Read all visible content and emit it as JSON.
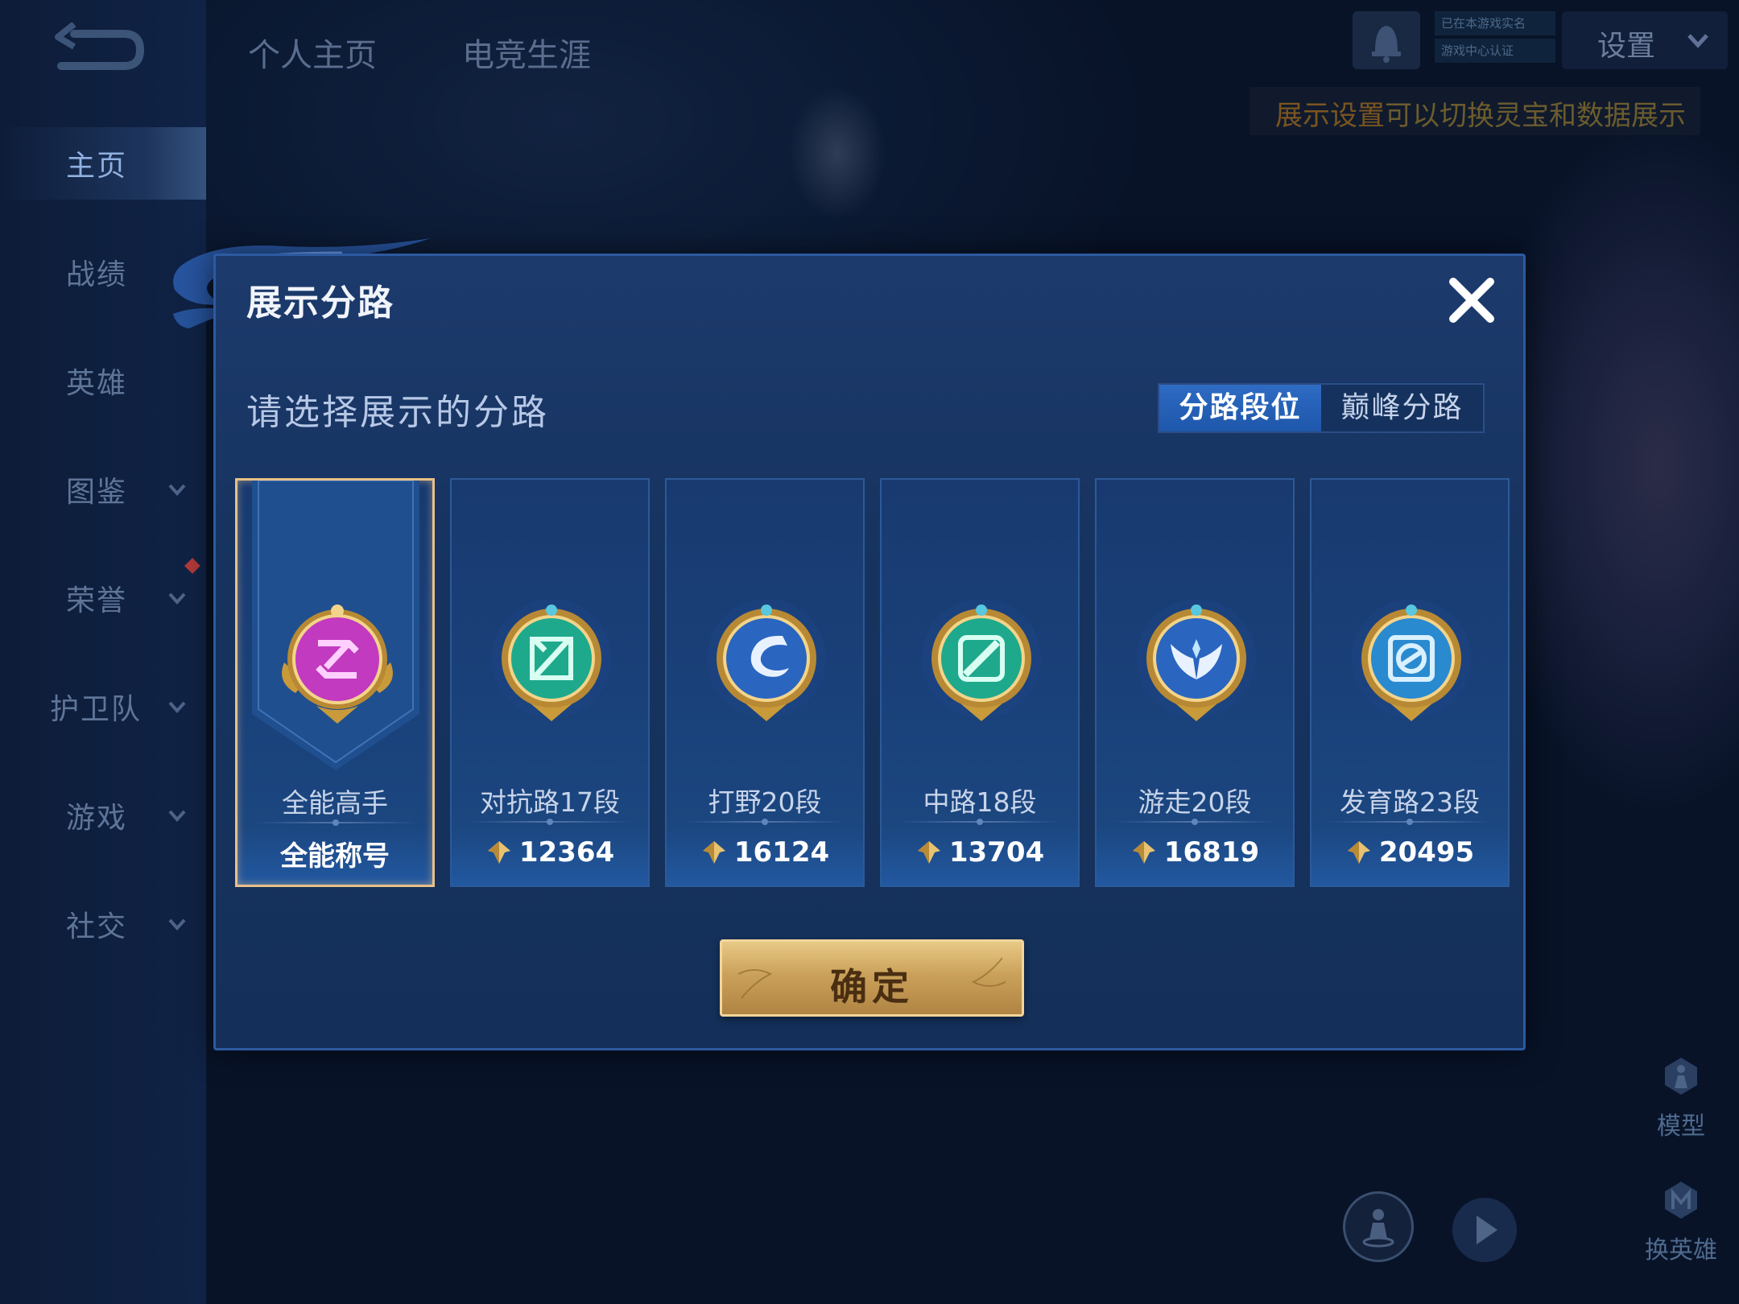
{
  "sidebar": {
    "items": [
      {
        "label": "主页",
        "active": true,
        "chevron": false
      },
      {
        "label": "战绩",
        "active": false,
        "chevron": false
      },
      {
        "label": "英雄",
        "active": false,
        "chevron": false
      },
      {
        "label": "图鉴",
        "active": false,
        "chevron": true
      },
      {
        "label": "荣誉",
        "active": false,
        "chevron": true
      },
      {
        "label": "护卫队",
        "active": false,
        "chevron": true
      },
      {
        "label": "游戏",
        "active": false,
        "chevron": true
      },
      {
        "label": "社交",
        "active": false,
        "chevron": true
      }
    ]
  },
  "topbar": {
    "tabs": [
      "个人主页",
      "电竞生涯"
    ],
    "verify_lines": [
      "已在本游戏实名",
      "游戏中心认证"
    ],
    "settings_label": "设置",
    "tip_highlight": "展示设置",
    "tip_text": "可以切换灵宝和数据展示"
  },
  "bottom_right": {
    "model_label": "模型",
    "switch_hero_label": "换英雄"
  },
  "modal": {
    "title": "展示分路",
    "subtitle": "请选择展示的分路",
    "tabs": [
      {
        "label": "分路段位",
        "active": true
      },
      {
        "label": "巅峰分路",
        "active": false
      }
    ],
    "cards": [
      {
        "name": "全能高手",
        "value": "全能称号",
        "medal_color": "#c23ac0",
        "selected": true,
        "icon": "all-round-medal-icon"
      },
      {
        "name": "对抗路17段",
        "value": "12364",
        "medal_color": "#1fa98c",
        "selected": false,
        "icon": "clash-lane-medal-icon"
      },
      {
        "name": "打野20段",
        "value": "16124",
        "medal_color": "#2a66c0",
        "selected": false,
        "icon": "jungle-medal-icon"
      },
      {
        "name": "中路18段",
        "value": "13704",
        "medal_color": "#1fa98c",
        "selected": false,
        "icon": "mid-lane-medal-icon"
      },
      {
        "name": "游走20段",
        "value": "16819",
        "medal_color": "#2a66c0",
        "selected": false,
        "icon": "roam-medal-icon"
      },
      {
        "name": "发育路23段",
        "value": "20495",
        "medal_color": "#2a66c0",
        "selected": false,
        "icon": "farm-lane-medal-icon"
      }
    ],
    "confirm_label": "确定"
  }
}
